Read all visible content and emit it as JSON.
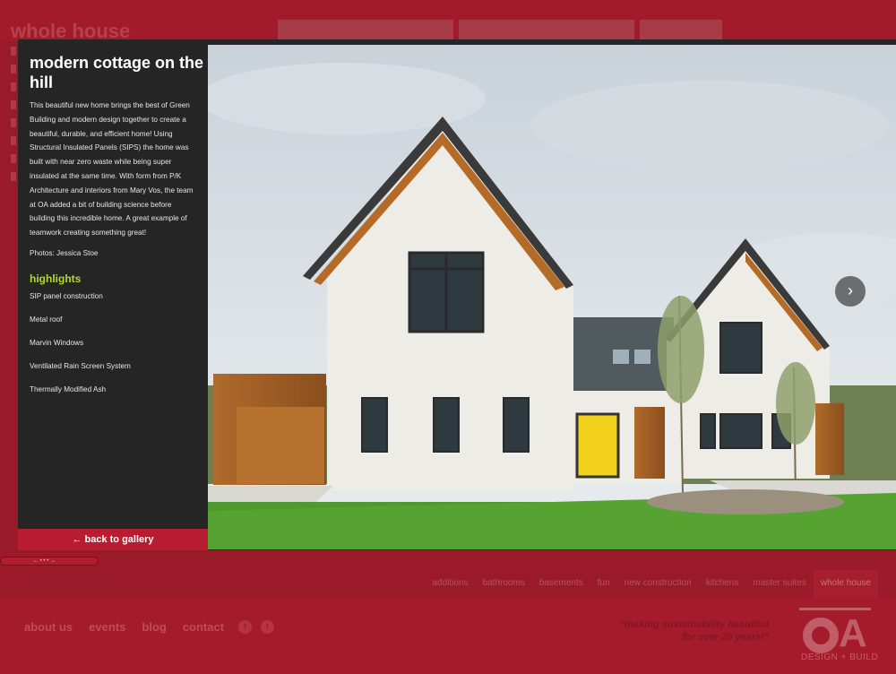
{
  "background_page": {
    "section_title": "whole house",
    "copyright": "© 2017 cologrease-stratcher",
    "categories": [
      {
        "label": "additions",
        "active": false
      },
      {
        "label": "bathrooms",
        "active": false
      },
      {
        "label": "basements",
        "active": false
      },
      {
        "label": "fun",
        "active": false
      },
      {
        "label": "new construction",
        "active": false
      },
      {
        "label": "kitchens",
        "active": false
      },
      {
        "label": "master suites",
        "active": false
      },
      {
        "label": "whole house",
        "active": true
      }
    ],
    "footer_links": [
      "about us",
      "events",
      "blog",
      "contact"
    ],
    "social": [
      {
        "icon": "facebook-icon",
        "glyph": "f"
      },
      {
        "icon": "twitter-icon",
        "glyph": "t"
      }
    ],
    "tagline_line1": "\"making sustainability beautiful",
    "tagline_line2": "for over 20 years!\"",
    "logo_sub": "DESIGN + BUILD"
  },
  "modal": {
    "title": "modern cottage on the hill",
    "description": "This beautiful new home brings the best of Green Building and modern design together to create a beautiful, durable, and efficient home! Using Structural Insulated Panels (SIPS) the home was built with near zero waste while being super insulated at the same time. With form from P/K Architecture and interiors from Mary Vos, the team at OA added a bit of building science before building this incredible home. A great example of teamwork creating something great!",
    "photos_credit": "Photos: Jessica Stoe",
    "highlights_title": "highlights",
    "highlights": [
      "SIP panel construction",
      "Metal roof",
      "Marvin Windows",
      "Ventilated Rain Screen System",
      "Thermally Modified Ash"
    ],
    "back_label": "← back to gallery",
    "next_icon": "chevron-right-icon",
    "next_glyph": "›"
  },
  "scroll_indicator": "← • • • →",
  "colors": {
    "brand_red": "#b71c30",
    "highlight_green": "#b6d534",
    "panel_dark": "#252525"
  }
}
